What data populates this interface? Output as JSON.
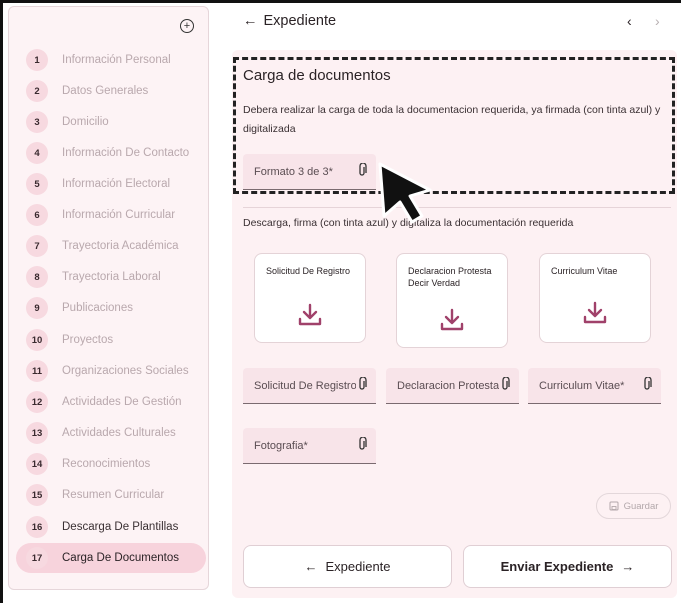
{
  "sidebar": {
    "steps": [
      {
        "num": "1",
        "label": "Información Personal"
      },
      {
        "num": "2",
        "label": "Datos Generales"
      },
      {
        "num": "3",
        "label": "Domicilio"
      },
      {
        "num": "4",
        "label": "Información De Contacto"
      },
      {
        "num": "5",
        "label": "Información Electoral"
      },
      {
        "num": "6",
        "label": "Información Curricular"
      },
      {
        "num": "7",
        "label": "Trayectoria Académica"
      },
      {
        "num": "8",
        "label": "Trayectoria Laboral"
      },
      {
        "num": "9",
        "label": "Publicaciones"
      },
      {
        "num": "10",
        "label": "Proyectos"
      },
      {
        "num": "11",
        "label": "Organizaciones Sociales"
      },
      {
        "num": "12",
        "label": "Actividades De Gestión"
      },
      {
        "num": "13",
        "label": "Actividades Culturales"
      },
      {
        "num": "14",
        "label": "Reconocimientos"
      },
      {
        "num": "15",
        "label": "Resumen Curricular"
      },
      {
        "num": "16",
        "label": "Descarga De Plantillas"
      },
      {
        "num": "17",
        "label": "Carga De Documentos"
      }
    ]
  },
  "header": {
    "back_arrow": "←",
    "title": "Expediente",
    "prev": "‹",
    "next": "›"
  },
  "upload_section": {
    "title": "Carga de documentos",
    "description": "Debera realizar la carga de toda la documentacion requerida, ya firmada (con tinta azul) y digitalizada",
    "field_label": "Formato 3 de 3*"
  },
  "download_section": {
    "description": "Descarga, firma (con tinta azul) y digitaliza la documentación requerida",
    "cards": [
      {
        "title": "Solicitud De Registro"
      },
      {
        "title": "Declaracion Protesta Decir Verdad"
      },
      {
        "title": "Curriculum Vitae"
      }
    ]
  },
  "fields": {
    "solicitud": "Solicitud De Registro",
    "declaracion": "Declaracion Protesta Dec",
    "curriculum": "Curriculum Vitae*",
    "fotografia": "Fotografia*"
  },
  "actions": {
    "guardar": "Guardar",
    "expediente": "Expediente",
    "enviar": "Enviar Expediente",
    "left_arrow": "←",
    "right_arrow": "→"
  },
  "colors": {
    "accent": "#a0416a",
    "panel": "#fdf1f3",
    "active_step": "#f7d3dc"
  },
  "icons": [
    "collapse-icon",
    "attach-icon",
    "download-icon",
    "save-icon",
    "cursor-icon"
  ]
}
